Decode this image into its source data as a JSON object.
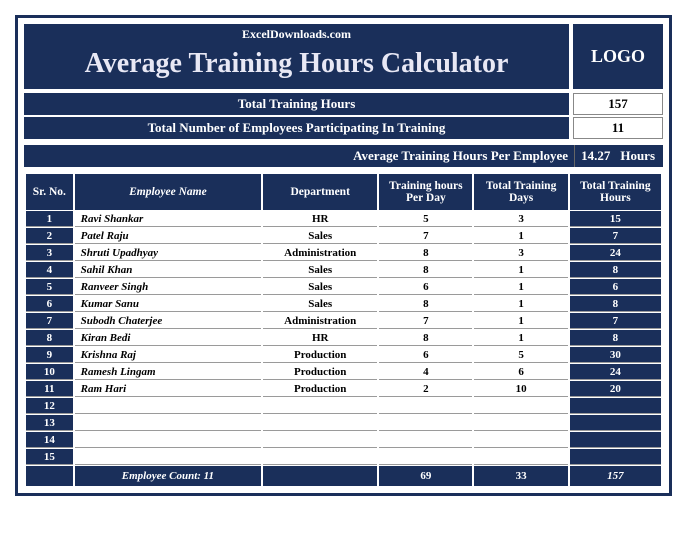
{
  "header": {
    "subtitle": "ExcelDownloads.com",
    "title": "Average Training Hours Calculator",
    "logo": "LOGO"
  },
  "summary": {
    "total_hours_label": "Total Training Hours",
    "total_hours_value": "157",
    "total_emp_label": "Total Number of Employees Participating In Training",
    "total_emp_value": "11",
    "avg_label": "Average Training Hours Per Employee",
    "avg_value": "14.27",
    "avg_unit": "Hours"
  },
  "columns": {
    "sn": "Sr. No.",
    "name": "Employee Name",
    "dept": "Department",
    "hpd": "Training hours Per Day",
    "days": "Total Training Days",
    "tot": "Total Training Hours"
  },
  "rows": [
    {
      "sn": "1",
      "name": "Ravi Shankar",
      "dept": "HR",
      "hpd": "5",
      "days": "3",
      "tot": "15"
    },
    {
      "sn": "2",
      "name": "Patel Raju",
      "dept": "Sales",
      "hpd": "7",
      "days": "1",
      "tot": "7"
    },
    {
      "sn": "3",
      "name": "Shruti Upadhyay",
      "dept": "Administration",
      "hpd": "8",
      "days": "3",
      "tot": "24"
    },
    {
      "sn": "4",
      "name": "Sahil Khan",
      "dept": "Sales",
      "hpd": "8",
      "days": "1",
      "tot": "8"
    },
    {
      "sn": "5",
      "name": "Ranveer Singh",
      "dept": "Sales",
      "hpd": "6",
      "days": "1",
      "tot": "6"
    },
    {
      "sn": "6",
      "name": "Kumar Sanu",
      "dept": "Sales",
      "hpd": "8",
      "days": "1",
      "tot": "8"
    },
    {
      "sn": "7",
      "name": "Subodh Chaterjee",
      "dept": "Administration",
      "hpd": "7",
      "days": "1",
      "tot": "7"
    },
    {
      "sn": "8",
      "name": "Kiran Bedi",
      "dept": "HR",
      "hpd": "8",
      "days": "1",
      "tot": "8"
    },
    {
      "sn": "9",
      "name": "Krishna Raj",
      "dept": "Production",
      "hpd": "6",
      "days": "5",
      "tot": "30"
    },
    {
      "sn": "10",
      "name": "Ramesh Lingam",
      "dept": "Production",
      "hpd": "4",
      "days": "6",
      "tot": "24"
    },
    {
      "sn": "11",
      "name": "Ram Hari",
      "dept": "Production",
      "hpd": "2",
      "days": "10",
      "tot": "20"
    },
    {
      "sn": "12",
      "name": "",
      "dept": "",
      "hpd": "",
      "days": "",
      "tot": ""
    },
    {
      "sn": "13",
      "name": "",
      "dept": "",
      "hpd": "",
      "days": "",
      "tot": ""
    },
    {
      "sn": "14",
      "name": "",
      "dept": "",
      "hpd": "",
      "days": "",
      "tot": ""
    },
    {
      "sn": "15",
      "name": "",
      "dept": "",
      "hpd": "",
      "days": "",
      "tot": ""
    }
  ],
  "footer": {
    "count_label": "Employee Count: 11",
    "sum_hpd": "69",
    "sum_days": "33",
    "sum_tot": "157"
  },
  "chart_data": {
    "type": "table",
    "title": "Average Training Hours Calculator",
    "columns": [
      "Sr. No.",
      "Employee Name",
      "Department",
      "Training hours Per Day",
      "Total Training Days",
      "Total Training Hours"
    ],
    "data": [
      [
        1,
        "Ravi Shankar",
        "HR",
        5,
        3,
        15
      ],
      [
        2,
        "Patel Raju",
        "Sales",
        7,
        1,
        7
      ],
      [
        3,
        "Shruti Upadhyay",
        "Administration",
        8,
        3,
        24
      ],
      [
        4,
        "Sahil Khan",
        "Sales",
        8,
        1,
        8
      ],
      [
        5,
        "Ranveer Singh",
        "Sales",
        6,
        1,
        6
      ],
      [
        6,
        "Kumar Sanu",
        "Sales",
        8,
        1,
        8
      ],
      [
        7,
        "Subodh Chaterjee",
        "Administration",
        7,
        1,
        7
      ],
      [
        8,
        "Kiran Bedi",
        "HR",
        8,
        1,
        8
      ],
      [
        9,
        "Krishna Raj",
        "Production",
        6,
        5,
        30
      ],
      [
        10,
        "Ramesh Lingam",
        "Production",
        4,
        6,
        24
      ],
      [
        11,
        "Ram Hari",
        "Production",
        2,
        10,
        20
      ]
    ],
    "totals": {
      "hours_per_day": 69,
      "days": 33,
      "total_hours": 157,
      "employee_count": 11,
      "avg_hours_per_employee": 14.27
    }
  }
}
